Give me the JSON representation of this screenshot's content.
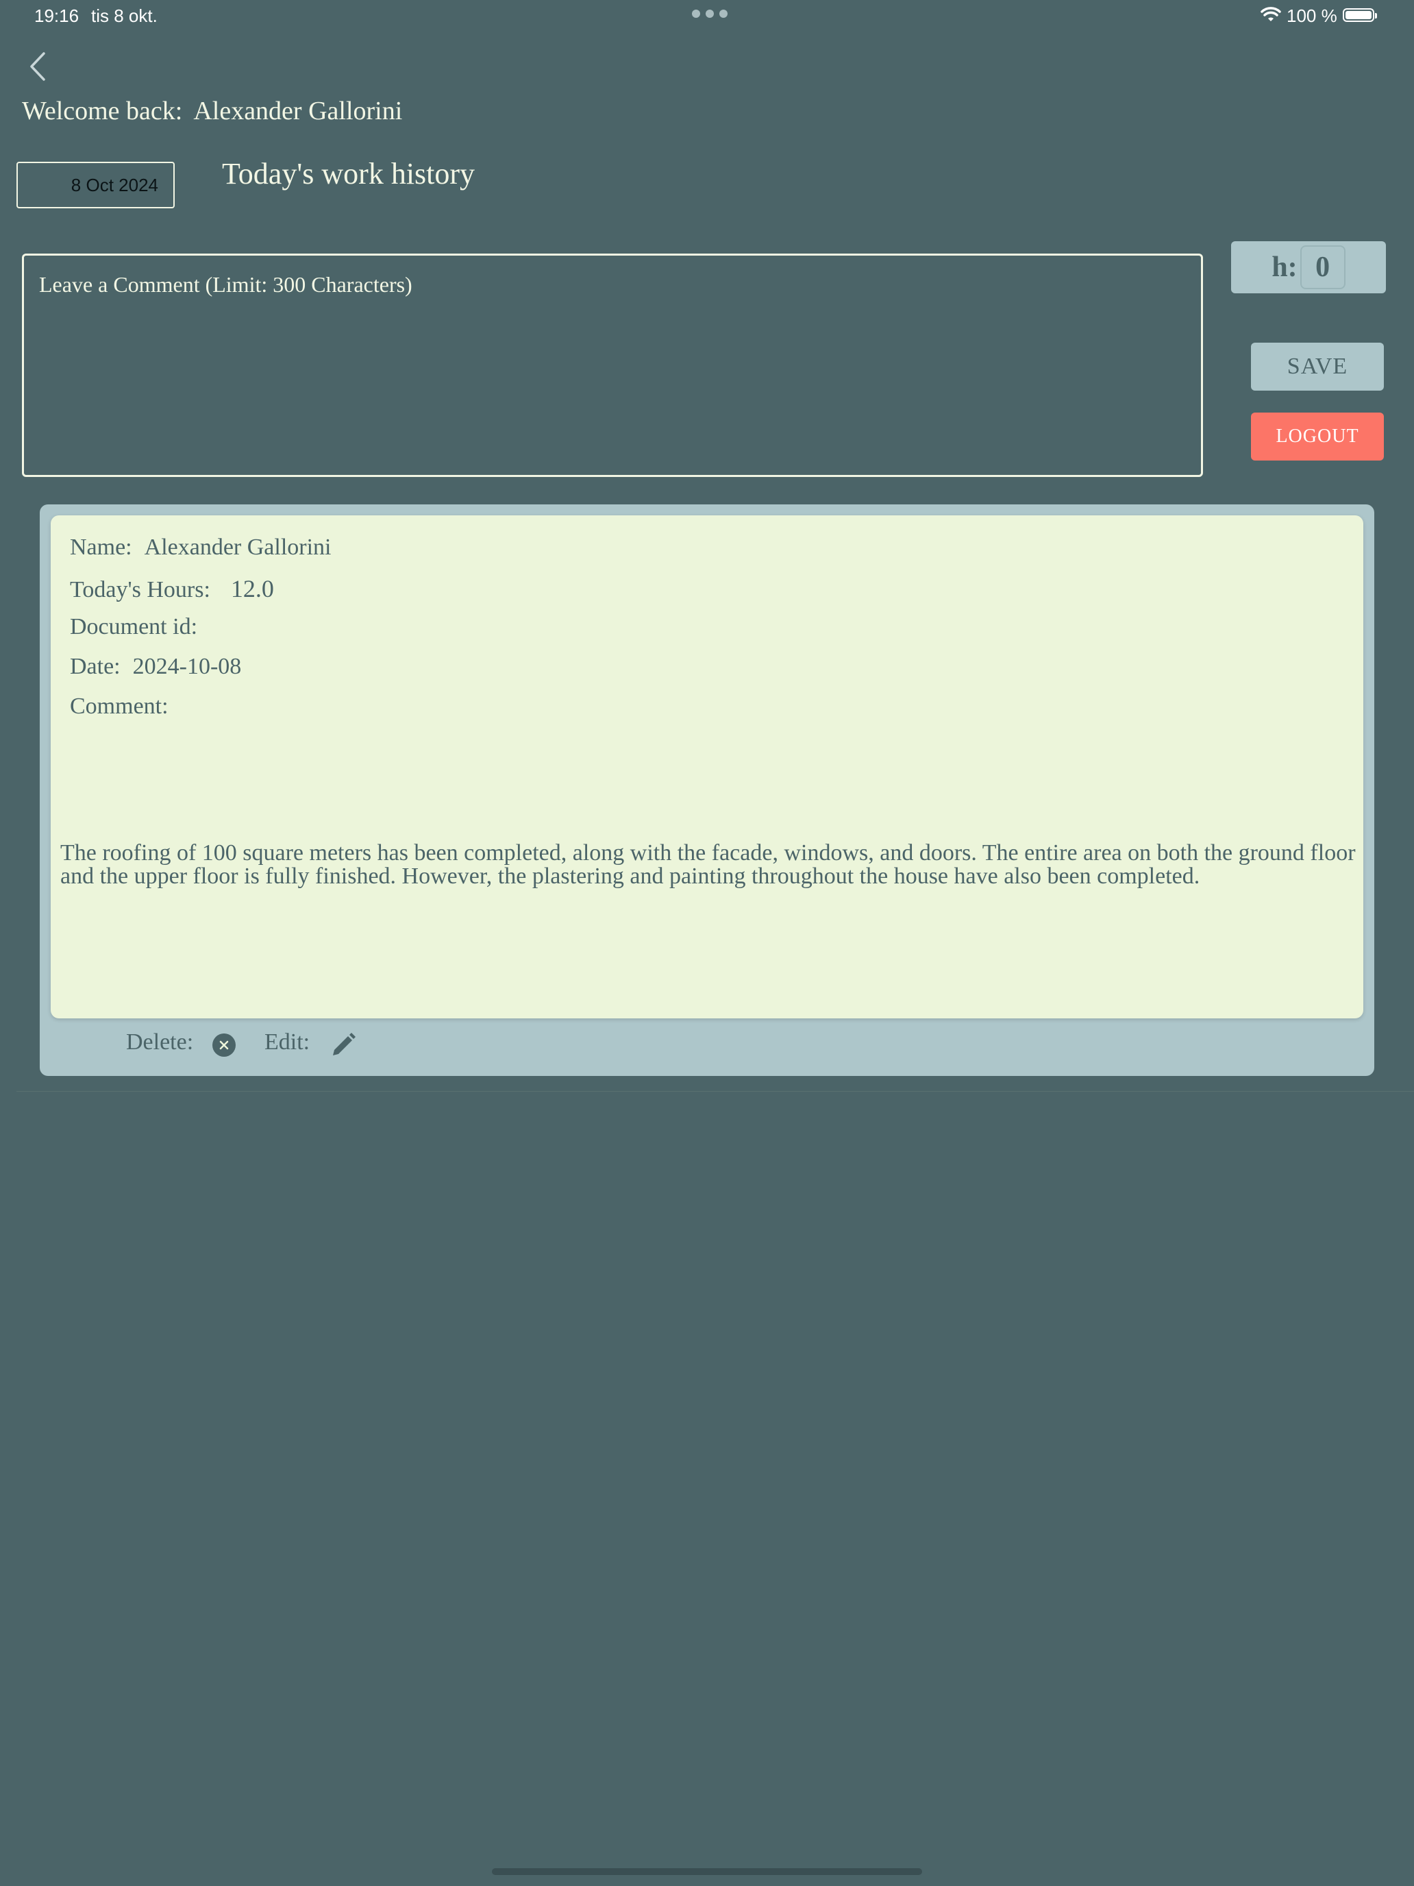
{
  "status_bar": {
    "time": "19:16",
    "date": "tis 8 okt.",
    "battery": "100 %"
  },
  "header": {
    "welcome_label": "Welcome back:",
    "user_name": "Alexander Gallorini",
    "date_value": "8 Oct 2024",
    "title": "Today's work history"
  },
  "comment_input": {
    "placeholder": "Leave a Comment (Limit: 300 Characters)"
  },
  "hours_input": {
    "label": "h:",
    "value": "0"
  },
  "buttons": {
    "save": "SAVE",
    "logout": "LOGOUT"
  },
  "record": {
    "name_label": "Name:",
    "name_value": "Alexander Gallorini",
    "hours_label": "Today's Hours:",
    "hours_value": "12.0",
    "docid_label": "Document id:",
    "docid_value": "",
    "date_label": "Date:",
    "date_value": "2024-10-08",
    "comment_label": "Comment:",
    "comment_text": "The roofing of 100 square meters has been completed, along with the facade, windows, and doors. The entire area on both the ground floor and the upper floor is fully finished. However, the plastering and painting throughout the house have also been completed.",
    "delete_label": "Delete:",
    "edit_label": "Edit:"
  },
  "colors": {
    "background": "#4b6468",
    "card_outer": "#adc6ca",
    "card_inner": "#ecf5da",
    "logout": "#fc7567",
    "text_light": "#f2f6e4"
  }
}
